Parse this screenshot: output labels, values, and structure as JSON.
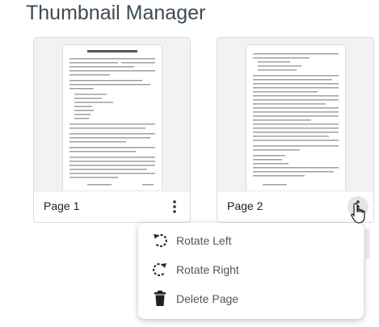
{
  "header": {
    "title": "Thumbnail Manager"
  },
  "pages": [
    {
      "label": "Page 1"
    },
    {
      "label": "Page 2"
    }
  ],
  "context_menu": {
    "items": [
      {
        "label": "Rotate Left",
        "icon": "rotate-left-icon"
      },
      {
        "label": "Rotate Right",
        "icon": "rotate-right-icon"
      },
      {
        "label": "Delete Page",
        "icon": "trash-icon"
      }
    ]
  },
  "colors": {
    "title": "#3c4a55",
    "card_bg": "#f5f5f5",
    "border": "#dcdcdc"
  }
}
